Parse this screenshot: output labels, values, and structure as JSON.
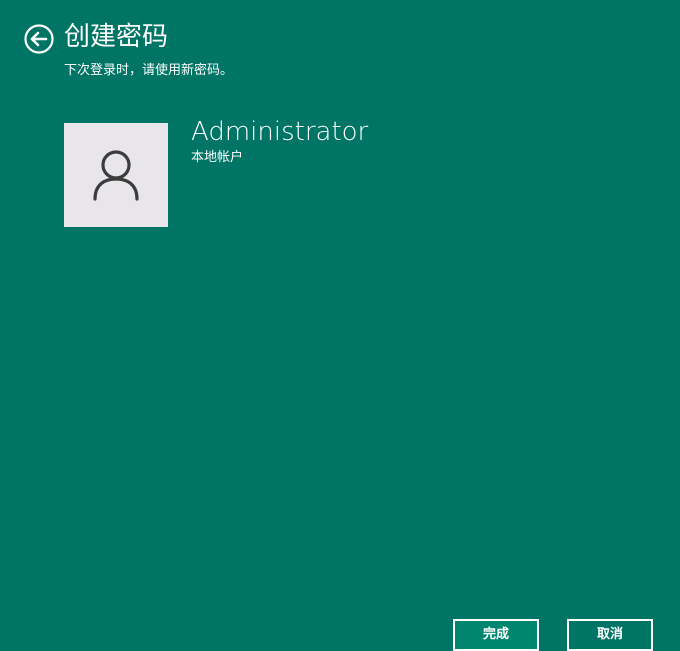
{
  "header": {
    "back_icon": "back-arrow-circle-icon",
    "title": "创建密码",
    "subtitle": "下次登录时，请使用新密码。"
  },
  "account": {
    "avatar_icon": "user-icon",
    "name": "Administrator",
    "type": "本地帐户"
  },
  "buttons": {
    "finish_label": "完成",
    "cancel_label": "取消"
  },
  "colors": {
    "background": "#007565",
    "avatar_background": "#e8e6ea",
    "avatar_figure": "#3c3c3c",
    "text": "#ffffff"
  }
}
